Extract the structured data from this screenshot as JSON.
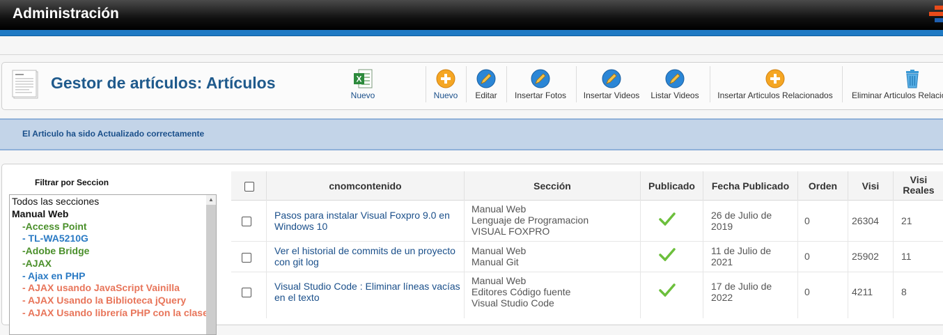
{
  "app": {
    "title": "Administración"
  },
  "header": {
    "title": "Gestor de artículos: Artículos"
  },
  "toolbar": {
    "buttons": [
      {
        "label": "Nuevo",
        "icon": "excel-icon"
      },
      {
        "label": "Nuevo",
        "icon": "plus-icon"
      },
      {
        "label": "Editar",
        "icon": "pencil-icon"
      },
      {
        "label": "Insertar Fotos",
        "icon": "pencil-icon"
      },
      {
        "label": "Insertar Videos",
        "icon": "pencil-icon"
      },
      {
        "label": "Listar Videos",
        "icon": "pencil-icon"
      },
      {
        "label": "Insertar Articulos Relacionados",
        "icon": "plus-icon"
      },
      {
        "label": "Eliminar Articulos Relacionados",
        "icon": "trash-icon"
      }
    ]
  },
  "notice": {
    "message": "El Articulo ha sido Actualizado correctamente"
  },
  "filter": {
    "title": "Filtrar por Seccion",
    "items": [
      "Todos las secciones",
      "Manual Web",
      "-Access Point",
      "- TL-WA5210G",
      "-Adobe Bridge",
      "-AJAX",
      "- Ajax en PHP",
      "- AJAX usando JavaScript Vainilla",
      "- AJAX Usando la Biblioteca jQuery",
      "- AJAX Usando librería PHP con la clase"
    ]
  },
  "table": {
    "columns": [
      "cnomcontenido",
      "Sección",
      "Publicado",
      "Fecha Publicado",
      "Orden",
      "Visi",
      "Visi Reales"
    ],
    "rows": [
      {
        "title": "Pasos para instalar Visual Foxpro 9.0 en Windows 10",
        "section": [
          "Manual Web",
          "Lenguaje de Programacion",
          "VISUAL FOXPRO"
        ],
        "date": "26 de Julio de 2019",
        "order": "0",
        "visits": "26304",
        "real": "21"
      },
      {
        "title": "Ver el historial de commits de un proyecto con git log",
        "section": [
          "Manual Web",
          "Manual Git"
        ],
        "date": "11 de Julio de 2021",
        "order": "0",
        "visits": "25902",
        "real": "11"
      },
      {
        "title": "Visual Studio Code : Eliminar líneas vacías en el texto",
        "section": [
          "Manual Web",
          "Editores Código fuente",
          "Visual Studio Code"
        ],
        "date": "17 de Julio de 2022",
        "order": "0",
        "visits": "4211",
        "real": "8"
      }
    ]
  },
  "colors": {
    "accent": "#1f7ac4",
    "link": "#1a4f8a",
    "green": "#4a8f2a",
    "orange": "#e8755a",
    "check": "#6cbf3c"
  }
}
